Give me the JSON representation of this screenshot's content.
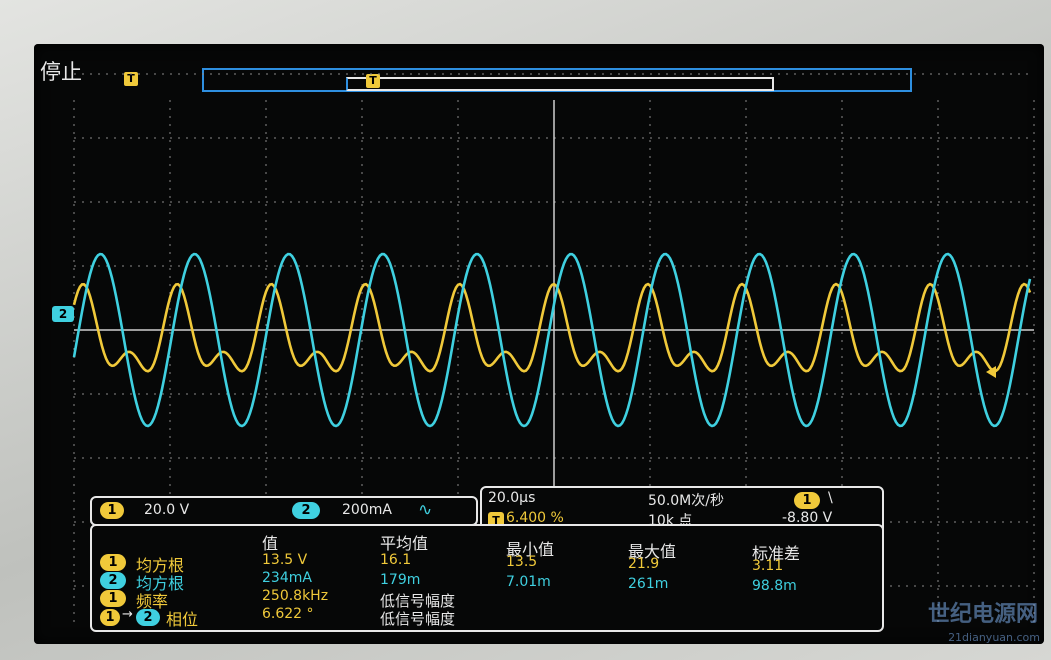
{
  "status": {
    "label": "停止"
  },
  "triggers": {
    "pos_label": "T",
    "view_label": "T"
  },
  "ch2_marker": "2",
  "channel_bar": {
    "ch1_badge": "1",
    "ch1_scale": "20.0 V",
    "ch2_badge": "2",
    "ch2_scale": "200mA",
    "coupling_symbol": "∿"
  },
  "time_box": {
    "timebase": "20.0µs",
    "trig_badge": "T",
    "trig_pos": "6.400 %",
    "sample_rate": "50.0M次/秒",
    "points": "10k 点",
    "trig_channel_badge": "1",
    "trig_slope": "\\",
    "trig_level": "-8.80 V"
  },
  "measurements": {
    "headers": [
      "值",
      "平均值",
      "最小值",
      "最大值",
      "标准差"
    ],
    "rows": [
      {
        "badge": "1",
        "label": "均方根",
        "color": "#f0c93a",
        "values": [
          "13.5 V",
          "16.1",
          "13.5",
          "21.9",
          "3.11"
        ]
      },
      {
        "badge": "2",
        "label": "均方根",
        "color": "#3fd0e0",
        "values": [
          "234mA",
          "179m",
          "7.01m",
          "261m",
          "98.8m"
        ]
      },
      {
        "badge": "1",
        "label": "频率",
        "color": "#f0c93a",
        "values": [
          "250.8kHz",
          "低信号幅度",
          "",
          "",
          ""
        ]
      },
      {
        "badge": "1",
        "badge2": "2",
        "label": "相位",
        "color": "#f0c93a",
        "values": [
          "6.622 °",
          "低信号幅度",
          "",
          "",
          ""
        ]
      }
    ]
  },
  "waveforms": {
    "ch1_color": "#f0c93a",
    "ch2_color": "#3fd0e0",
    "cycles_visible": 10.2
  },
  "watermark": {
    "title": "世纪电源网",
    "url": "21dianyuan.com"
  }
}
